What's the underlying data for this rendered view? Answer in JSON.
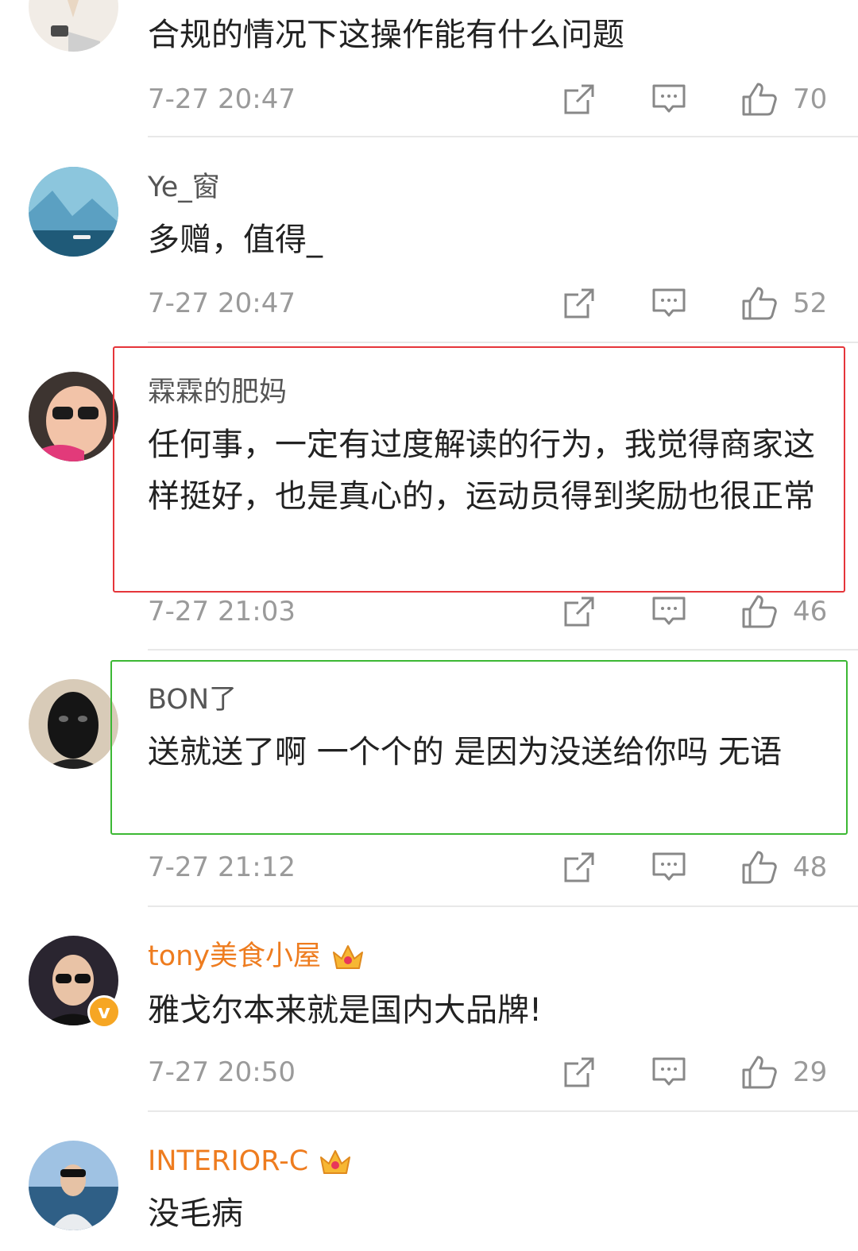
{
  "comments": [
    {
      "username": "",
      "text": "合规的情况下这操作能有什么问题",
      "time": "7-27 20:47",
      "likes": "70",
      "avatar_icon": "praying-hands-avatar"
    },
    {
      "username": "Ye_窗",
      "text": "多赠，值得_",
      "time": "7-27 20:47",
      "likes": "52",
      "avatar_icon": "iceberg-swimmer-avatar"
    },
    {
      "username": "霖霖的肥妈",
      "text": "任何事，一定有过度解读的行为，我觉得商家这样挺好，也是真心的，运动员得到奖励也很正常",
      "time": "7-27 21:03",
      "likes": "46",
      "avatar_icon": "child-sunglasses-avatar",
      "highlight": "#e5353a"
    },
    {
      "username": "BON了",
      "text": "送就送了啊 一个个的 是因为没送给你吗 无语",
      "time": "7-27 21:12",
      "likes": "48",
      "avatar_icon": "black-mask-avatar",
      "highlight": "#3cb834"
    },
    {
      "username": "tony美食小屋",
      "text": "雅戈尔本来就是国内大品牌!",
      "time": "7-27 20:50",
      "likes": "29",
      "avatar_icon": "man-sunglasses-avatar",
      "vip": true,
      "verified": true
    },
    {
      "username": "INTERIOR-C",
      "text": "没毛病",
      "avatar_icon": "man-seaside-avatar",
      "vip": true
    }
  ],
  "icons": {
    "share": "share-icon",
    "comment": "comment-icon",
    "like": "thumbs-up-icon",
    "crown": "crown-icon"
  },
  "colors": {
    "vip_name": "#ee7c1f",
    "highlight_red": "#e5353a",
    "highlight_green": "#3cb834",
    "meta_gray": "#9a9a9a",
    "text": "#222222"
  }
}
